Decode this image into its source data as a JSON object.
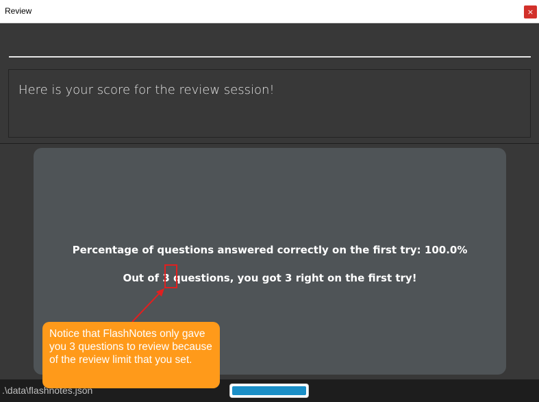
{
  "window": {
    "title": "Review",
    "close_label": "×"
  },
  "command_box": {
    "value": "",
    "placeholder": ""
  },
  "result_display": {
    "text": "Here is your score for the review session!"
  },
  "score": {
    "percentage_line": "Percentage of questions answered correctly on the first try: 100.0%",
    "count_line": "Out of 3 questions, you got 3 right on the first try!"
  },
  "status_bar": {
    "file_path": ".\\data\\flashnotes.json",
    "progress": 1.0
  },
  "annotation": {
    "callout_text": "Notice that FlashNotes only gave you 3 questions to review because of the review limit that you set.",
    "callout_color": "#ff9a1a",
    "highlight_color": "#e02020"
  }
}
